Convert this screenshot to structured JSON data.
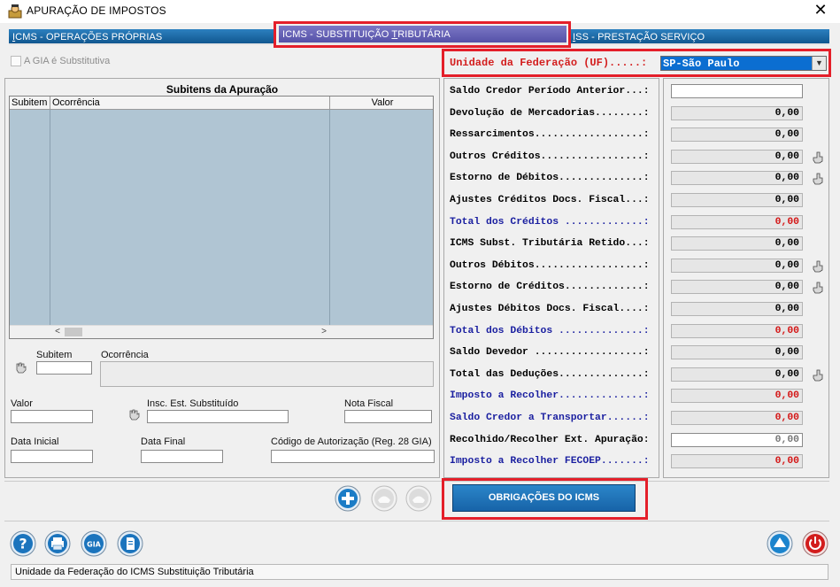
{
  "window": {
    "title": "APURAÇÃO  DE  IMPOSTOS",
    "close": "✕"
  },
  "tabs": {
    "icms_op": {
      "underline": "I",
      "rest": "CMS - OPERAÇÕES PRÓPRIAS"
    },
    "icms_st": {
      "pre": "ICMS - SUBSTITUIÇÃO ",
      "underline": "T",
      "rest": "RIBUTÁRIA"
    },
    "iss": {
      "underline": "I",
      "rest": "SS - PRESTAÇÃO SERVIÇO"
    }
  },
  "gia_checkbox": {
    "label": "A GIA é Substitutiva"
  },
  "uf": {
    "label": "Unidade da Federação (UF).....:",
    "value": "SP-São Paulo"
  },
  "subitens": {
    "title": "Subitens da Apuração",
    "columns": [
      "Subitem",
      "Ocorrência",
      "Valor"
    ]
  },
  "form": {
    "subitem": "Subitem",
    "ocorrencia": "Ocorrência",
    "valor": "Valor",
    "insc_est": "Insc. Est. Substituído",
    "nota_fiscal": "Nota Fiscal",
    "data_inicial": "Data Inicial",
    "data_final": "Data Final",
    "codigo_aut": "Código de Autorização (Reg. 28 GIA)"
  },
  "apuracao": [
    {
      "label": "Saldo Credor Período Anterior...:",
      "value": "",
      "color": "black",
      "box": "white",
      "hand": false
    },
    {
      "label": "Devolução de Mercadorias........:",
      "value": "0,00",
      "color": "black",
      "box": "gray",
      "hand": false
    },
    {
      "label": "Ressarcimentos..................:",
      "value": "0,00",
      "color": "black",
      "box": "gray",
      "hand": false
    },
    {
      "label": "Outros Créditos.................:",
      "value": "0,00",
      "color": "black",
      "box": "gray",
      "hand": true
    },
    {
      "label": "Estorno de Débitos..............:",
      "value": "0,00",
      "color": "black",
      "box": "gray",
      "hand": true
    },
    {
      "label": "Ajustes Créditos Docs. Fiscal...:",
      "value": "0,00",
      "color": "black",
      "box": "gray",
      "hand": false
    },
    {
      "label": "Total dos Créditos .............:",
      "value": "0,00",
      "color": "blue",
      "box": "red",
      "hand": false
    },
    {
      "label": "ICMS Subst. Tributária Retido...:",
      "value": "0,00",
      "color": "black",
      "box": "gray",
      "hand": false
    },
    {
      "label": "Outros Débitos..................:",
      "value": "0,00",
      "color": "black",
      "box": "gray",
      "hand": true
    },
    {
      "label": "Estorno de Créditos.............:",
      "value": "0,00",
      "color": "black",
      "box": "gray",
      "hand": true
    },
    {
      "label": "Ajustes Débitos Docs. Fiscal....:",
      "value": "0,00",
      "color": "black",
      "box": "gray",
      "hand": false
    },
    {
      "label": "Total dos Débitos ..............:",
      "value": "0,00",
      "color": "blue",
      "box": "red",
      "hand": false
    },
    {
      "label": "Saldo Devedor ..................:",
      "value": "0,00",
      "color": "black",
      "box": "gray",
      "hand": false
    },
    {
      "label": "Total das Deduções..............:",
      "value": "0,00",
      "color": "black",
      "box": "gray",
      "hand": true
    },
    {
      "label": "Imposto a Recolher..............:",
      "value": "0,00",
      "color": "blue",
      "box": "red",
      "hand": false
    },
    {
      "label": "Saldo Credor a Transportar......:",
      "value": "0,00",
      "color": "blue",
      "box": "red",
      "hand": false
    },
    {
      "label": "Recolhido/Recolher Ext. Apuração:",
      "value": "0,00",
      "color": "black",
      "box": "white-gray",
      "hand": false
    },
    {
      "label": "Imposto a Recolher FECOEP.......:",
      "value": "0,00",
      "color": "blue",
      "box": "red",
      "hand": false
    }
  ],
  "buttons": {
    "obrigacoes": "OBRIGAÇÕES DO ICMS",
    "gia": "GIA"
  },
  "status": "Unidade da Federação do ICMS Substituição Tributária",
  "colors": {
    "tab_blue": "#1a6aa8",
    "tab_active": "#6a66b8",
    "highlight_red": "#e41f2a",
    "value_red": "#d41515",
    "label_blue": "#1a1fa0"
  }
}
